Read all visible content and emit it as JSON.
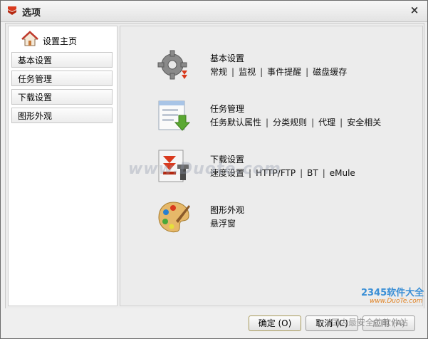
{
  "window": {
    "title": "选项",
    "close_glyph": "×"
  },
  "sidebar": {
    "home_label": "设置主页",
    "items": [
      {
        "label": "基本设置"
      },
      {
        "label": "任务管理"
      },
      {
        "label": "下载设置"
      },
      {
        "label": "图形外观"
      }
    ]
  },
  "categories": [
    {
      "title": "基本设置",
      "links": [
        "常规",
        "监视",
        "事件提醒",
        "磁盘缓存"
      ],
      "icon": "gear-icon"
    },
    {
      "title": "任务管理",
      "links": [
        "任务默认属性",
        "分类规则",
        "代理",
        "安全相关"
      ],
      "icon": "task-list-icon"
    },
    {
      "title": "下载设置",
      "links": [
        "速度设置",
        "HTTP/FTP",
        "BT",
        "eMule"
      ],
      "icon": "download-icon"
    },
    {
      "title": "图形外观",
      "links": [
        "悬浮窗"
      ],
      "icon": "palette-icon"
    }
  ],
  "separator": "|",
  "buttons": {
    "ok": "确定 (O)",
    "cancel": "取消 (C)",
    "apply": "应用 (A)"
  },
  "watermark": "www.Duote.com",
  "badge": {
    "logo": "2345软件大全",
    "url": "www.DuoTe.com",
    "text": "国内最安全的软件站"
  },
  "colors": {
    "accent_red": "#d93a1e",
    "gear_gray": "#7a7a7a",
    "download_green": "#5aa832"
  }
}
